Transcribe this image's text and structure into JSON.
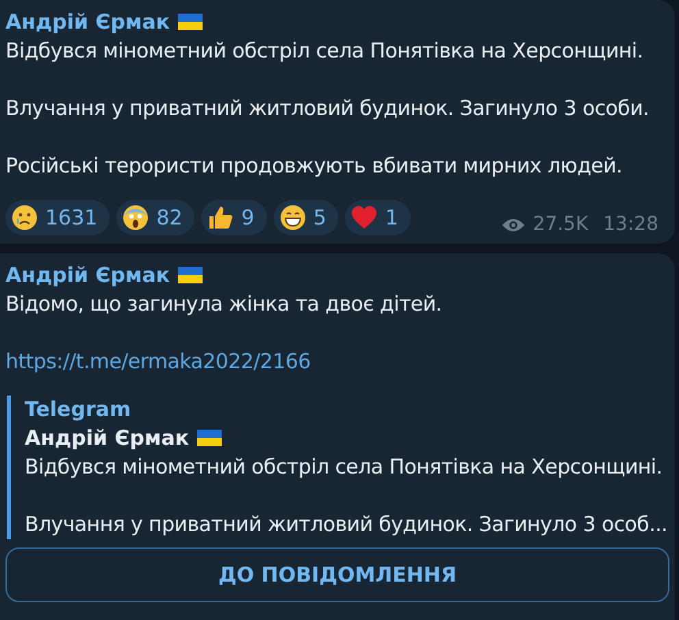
{
  "messages": [
    {
      "author": "Андрій Єрмак",
      "paragraphs": [
        "Відбувся мінометний обстріл села Понятівка на Херсонщині.",
        "Влучання у приватний житловий будинок. Загинуло 3 особи.",
        "Російські терористи продовжують вбивати мирних людей."
      ],
      "reactions": [
        {
          "kind": "crying",
          "count": "1631"
        },
        {
          "kind": "scream",
          "count": "82"
        },
        {
          "kind": "thumbs",
          "count": "9"
        },
        {
          "kind": "grin",
          "count": "5"
        },
        {
          "kind": "heart",
          "count": "1"
        }
      ],
      "views": "27.5K",
      "time": "13:28"
    },
    {
      "author": "Андрій Єрмак",
      "paragraphs": [
        "Відомо, що загинула жінка та двоє дітей."
      ],
      "link": "https://t.me/ermaka2022/2166",
      "preview": {
        "site": "Telegram",
        "title": "Андрій Єрмак",
        "paragraphs": [
          "Відбувся мінометний обстріл села Понятівка на Херсонщині.",
          "Влучання у приватний житловий будинок. Загинуло 3 особ..."
        ]
      },
      "button": "ДО ПОВІДОМЛЕННЯ"
    }
  ]
}
